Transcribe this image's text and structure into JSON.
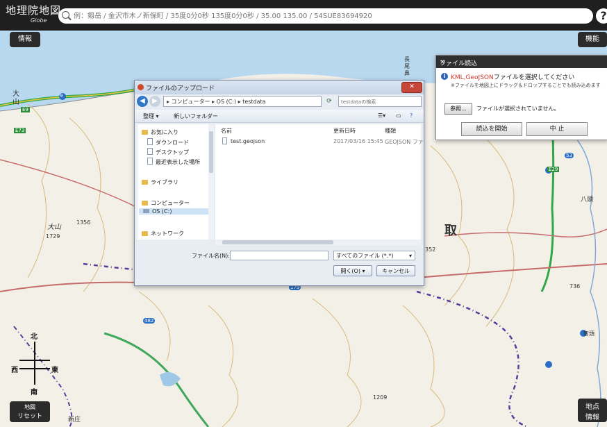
{
  "app": {
    "logo": "地理院地図",
    "logo_sub": "Globe",
    "search_placeholder": "例：剱岳 / 金沢市木ノ新保町 / 35度0分0秒 135度0分0秒 / 35.00 135.00 / 54SUE83694920",
    "help_label": "?"
  },
  "map_buttons": {
    "info": "情報",
    "functions": "機能",
    "reset_line1": "地図",
    "reset_line2": "リセット",
    "point_info_line1": "地点",
    "point_info_line2": "情報"
  },
  "map_labels": {
    "daisen_1": "大",
    "daisen_2": "山",
    "nagao_1": "長",
    "nagao_2": "尾",
    "nagao_3": "鼻",
    "tottori": "取",
    "oyama": "大山",
    "elev_1": "1356",
    "elev_2": "1729",
    "elev_3": "1209",
    "elev_4": "352",
    "elev_5": "736",
    "hattou": "八頭",
    "wakasa": "智頭",
    "shinjo": "新庄",
    "road_e9": "E9",
    "road_e29": "E29",
    "road_e73": "E73",
    "road_9": "9",
    "road_53": "53",
    "road_482": "482",
    "road_179": "179"
  },
  "compass": {
    "north": "北",
    "east": "東",
    "west": "西",
    "south": "南"
  },
  "upload_dialog": {
    "title": "ファイルのアップロード",
    "close": "✕",
    "address": "▸ コンピューター ▸ OS (C:) ▸ testdata",
    "search_placeholder": "testdataの検索",
    "toolbar_organize": "整理 ▾",
    "toolbar_new_folder": "新しいフォルダー",
    "nav": [
      {
        "label": "お気に入り",
        "type": "folder"
      },
      {
        "label": "ダウンロード",
        "type": "doc"
      },
      {
        "label": "デスクトップ",
        "type": "doc"
      },
      {
        "label": "最近表示した場所",
        "type": "doc"
      },
      {
        "label": "ライブラリ",
        "type": "folder"
      },
      {
        "label": "コンピューター",
        "type": "folder"
      },
      {
        "label": "OS (C:)",
        "type": "drive"
      },
      {
        "label": "ネットワーク",
        "type": "folder"
      }
    ],
    "columns": [
      "名前",
      "更新日時",
      "種類"
    ],
    "files": [
      {
        "name": "test.geojson",
        "date": "2017/03/16 15:45",
        "type": "GEOJSON ファ"
      }
    ],
    "filename_label": "ファイル名(N):",
    "filetype": "すべてのファイル (*.*)",
    "open_button": "開く(O)",
    "cancel_button": "キャンセル"
  },
  "import_dialog": {
    "title": "ファイル読込",
    "close": "×",
    "message_highlight": "KML,GeoJSON",
    "message_rest": "ファイルを選択してください",
    "note": "※ファイルを地図上にドラッグ＆ドロップすることでも読み込めます",
    "browse_button": "参照...",
    "no_file": "ファイルが選択されていません。",
    "start_button": "読込を開始",
    "cancel_button": "中 止"
  }
}
